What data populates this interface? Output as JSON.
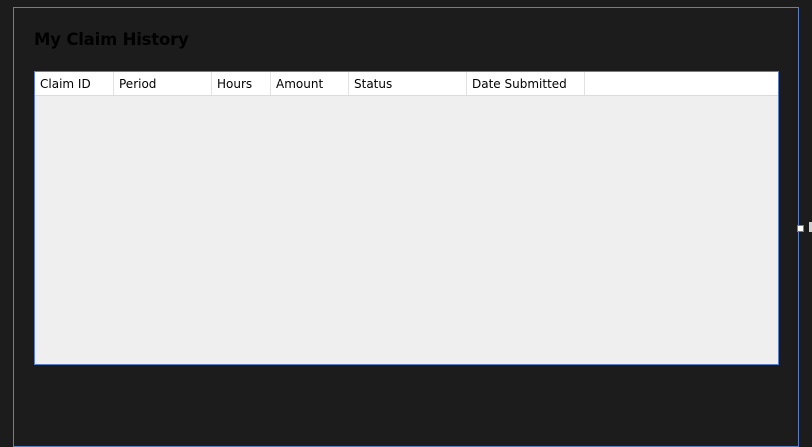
{
  "page": {
    "title": "My Claim History"
  },
  "grid": {
    "columns": [
      {
        "label": "Claim ID"
      },
      {
        "label": "Period"
      },
      {
        "label": "Hours"
      },
      {
        "label": "Amount"
      },
      {
        "label": "Status"
      },
      {
        "label": "Date Submitted"
      },
      {
        "label": ""
      }
    ],
    "rows": []
  },
  "colors": {
    "background": "#1c1c1c",
    "frame_border": "#5b7fc7",
    "grid_background": "#efefef",
    "header_background": "#ffffff"
  }
}
